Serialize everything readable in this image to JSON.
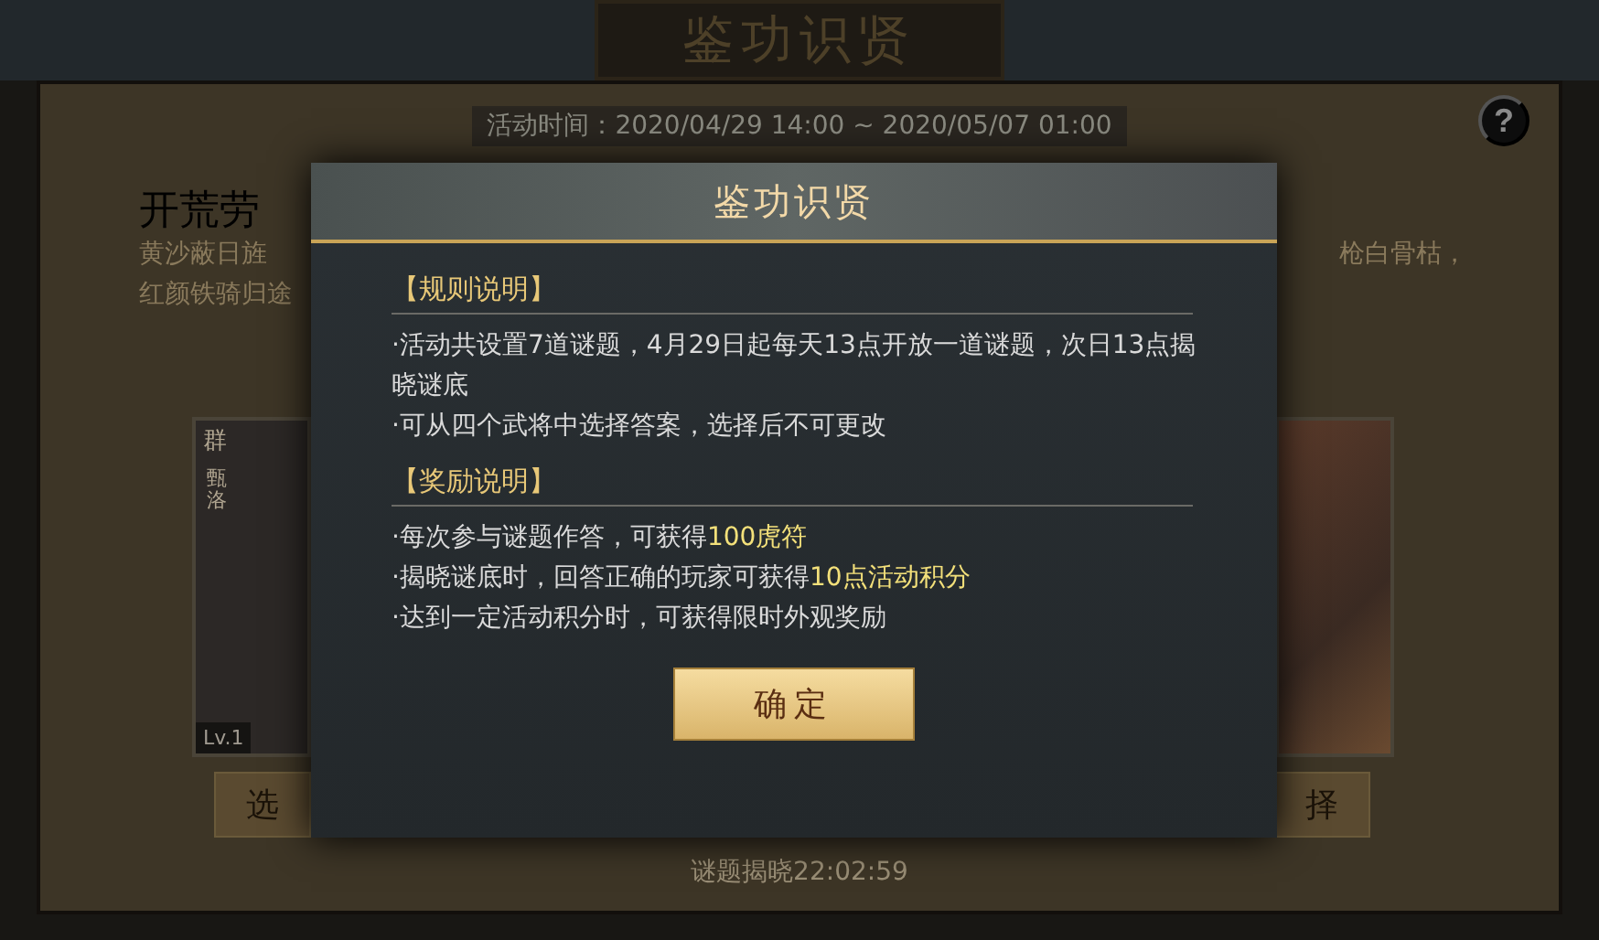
{
  "background": {
    "banner_title": "鉴功识贤",
    "event_time": "活动时间：2020/04/29 14:00 ~ 2020/05/07 01:00",
    "help": "?",
    "heading": "开荒劳",
    "lines": [
      "黄沙蔽日旌",
      "红颜铁骑归途"
    ],
    "right_line": "枪白骨枯，",
    "cards": [
      {
        "kind": "portrait",
        "faction": "群",
        "name": "甄洛",
        "level": "Lv.1"
      },
      {
        "kind": "artwork"
      }
    ],
    "choose_buttons": [
      "选",
      "择"
    ],
    "countdown": "谜题揭晓22:02:59"
  },
  "dialog": {
    "title": "鉴功识贤",
    "sections": [
      {
        "heading": "【规则说明】",
        "items": [
          "·活动共设置7道谜题，4月29日起每天13点开放一道谜题，次日13点揭晓谜底",
          "·可从四个武将中选择答案，选择后不可更改"
        ]
      },
      {
        "heading": "【奖励说明】",
        "items": [
          "·每次参与谜题作答，可获得**100虎符**",
          "·揭晓谜底时，回答正确的玩家可获得**10点活动积分**",
          "·达到一定活动积分时，可获得限时外观奖励"
        ]
      }
    ],
    "confirm": "确定"
  }
}
